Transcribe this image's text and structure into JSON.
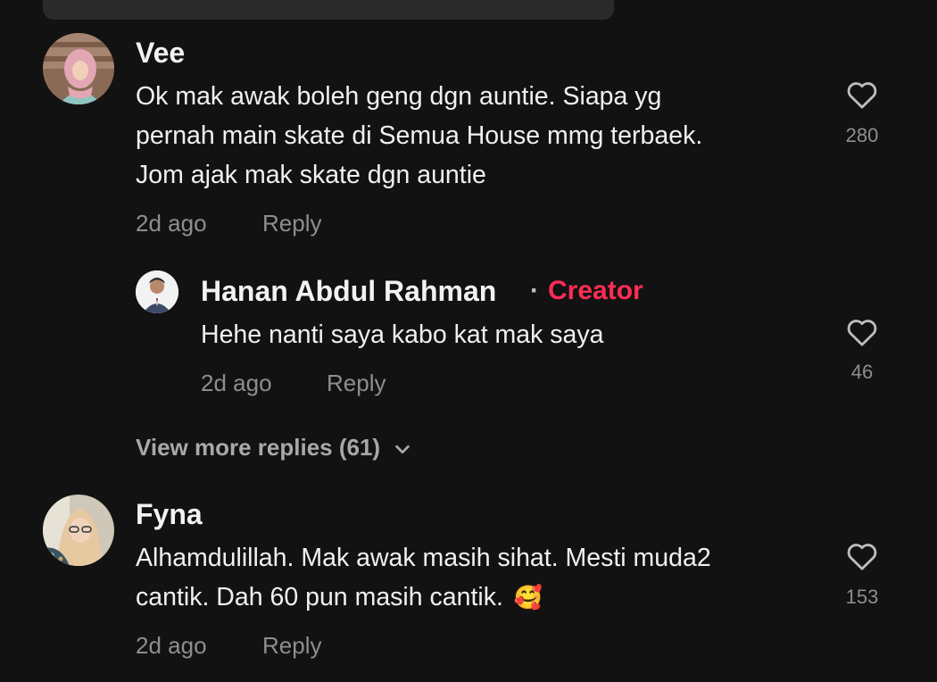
{
  "comments": [
    {
      "username": "Vee",
      "avatar_icon": "avatar-hijab-pink",
      "lines": [
        "Ok mak awak boleh geng dgn auntie. Siapa yg",
        "pernah main skate di Semua House mmg terbaek.",
        "Jom ajak mak skate dgn auntie"
      ],
      "time": "2d ago",
      "reply_label": "Reply",
      "likes": "280"
    },
    {
      "username": "Fyna",
      "avatar_icon": "avatar-hijab-glasses",
      "lines": [
        "Alhamdulillah. Mak awak masih sihat. Mesti muda2",
        "cantik. Dah 60 pun masih cantik."
      ],
      "emoji": "🥰",
      "time": "2d ago",
      "reply_label": "Reply",
      "likes": "153"
    }
  ],
  "reply": {
    "username": "Hanan Abdul Rahman",
    "separator": "·",
    "badge": "Creator",
    "avatar_icon": "avatar-man-suit",
    "text": "Hehe nanti saya kabo kat mak saya",
    "time": "2d ago",
    "reply_label": "Reply",
    "likes": "46"
  },
  "view_more": {
    "label": "View more replies (61)",
    "icon": "chevron-down-icon"
  },
  "colors": {
    "background": "#121212",
    "creator": "#fe2c55",
    "muted": "#8e8e8e"
  }
}
